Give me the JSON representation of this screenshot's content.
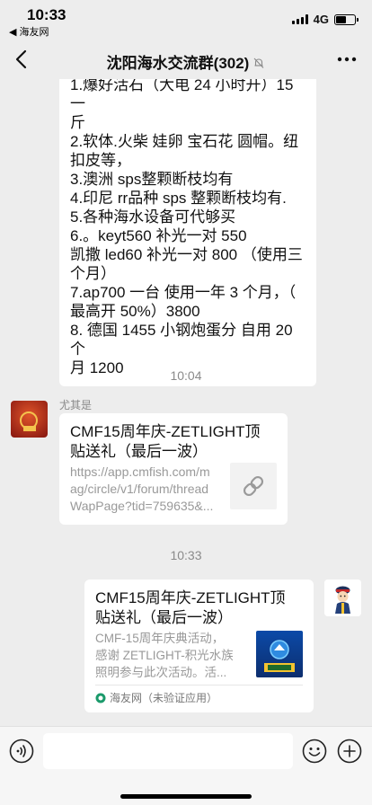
{
  "status_bar": {
    "time": "10:33",
    "back_app": "◀ 海友网",
    "network": "4G"
  },
  "nav": {
    "title": "沈阳海水交流群(302)"
  },
  "messages": {
    "first_bubble_lines": [
      "1.爆好活石（大电 24 小时开）15 一",
      "斤",
      "2.软体.火柴 娃卵 宝石花 圆帽。纽",
      "扣皮等，",
      "3.澳洲 sps整颗断枝均有",
      "4.印尼 rr品种 sps 整颗断枝均有.",
      "5.各种海水设备可代够买",
      "6.。keyt560 补光一对 550",
      "凯撒 led60 补光一对 800 （使用三",
      "个月）",
      "7.ap700 一台 使用一年 3 个月，（",
      "最高开 50%）3800",
      "8. 德国 1455 小钢炮蛋分 自用 20 个",
      "月 1200"
    ],
    "timestamp_1": "10:04",
    "sender_name": "尤其是",
    "link1": {
      "title": "CMF15周年庆-ZETLIGHT顶贴送礼（最后一波）",
      "title_line1": "CMF15周年庆-ZETLIGHT顶",
      "title_line2": "贴送礼（最后一波）",
      "url_line1": "https://app.cmfish.com/m",
      "url_line2": "ag/circle/v1/forum/thread",
      "url_line3": "WapPage?tid=759635&..."
    },
    "timestamp_2": "10:33",
    "link2": {
      "title_line1": "CMF15周年庆-ZETLIGHT顶",
      "title_line2": "贴送礼（最后一波）",
      "desc_line1": "CMF-15周年庆典活动，",
      "desc_line2": "感谢 ZETLIGHT-积光水族",
      "desc_line3": "照明参与此次活动。活...",
      "source": "海友网（未验证应用）"
    }
  },
  "colors": {
    "background": "#ededed",
    "bubble": "#ffffff",
    "meta_text": "#8a8a8a"
  },
  "icons": [
    "back-arrow-icon",
    "mute-bell-icon",
    "more-icon",
    "link-icon",
    "voice-icon",
    "emoji-icon",
    "plus-icon"
  ]
}
